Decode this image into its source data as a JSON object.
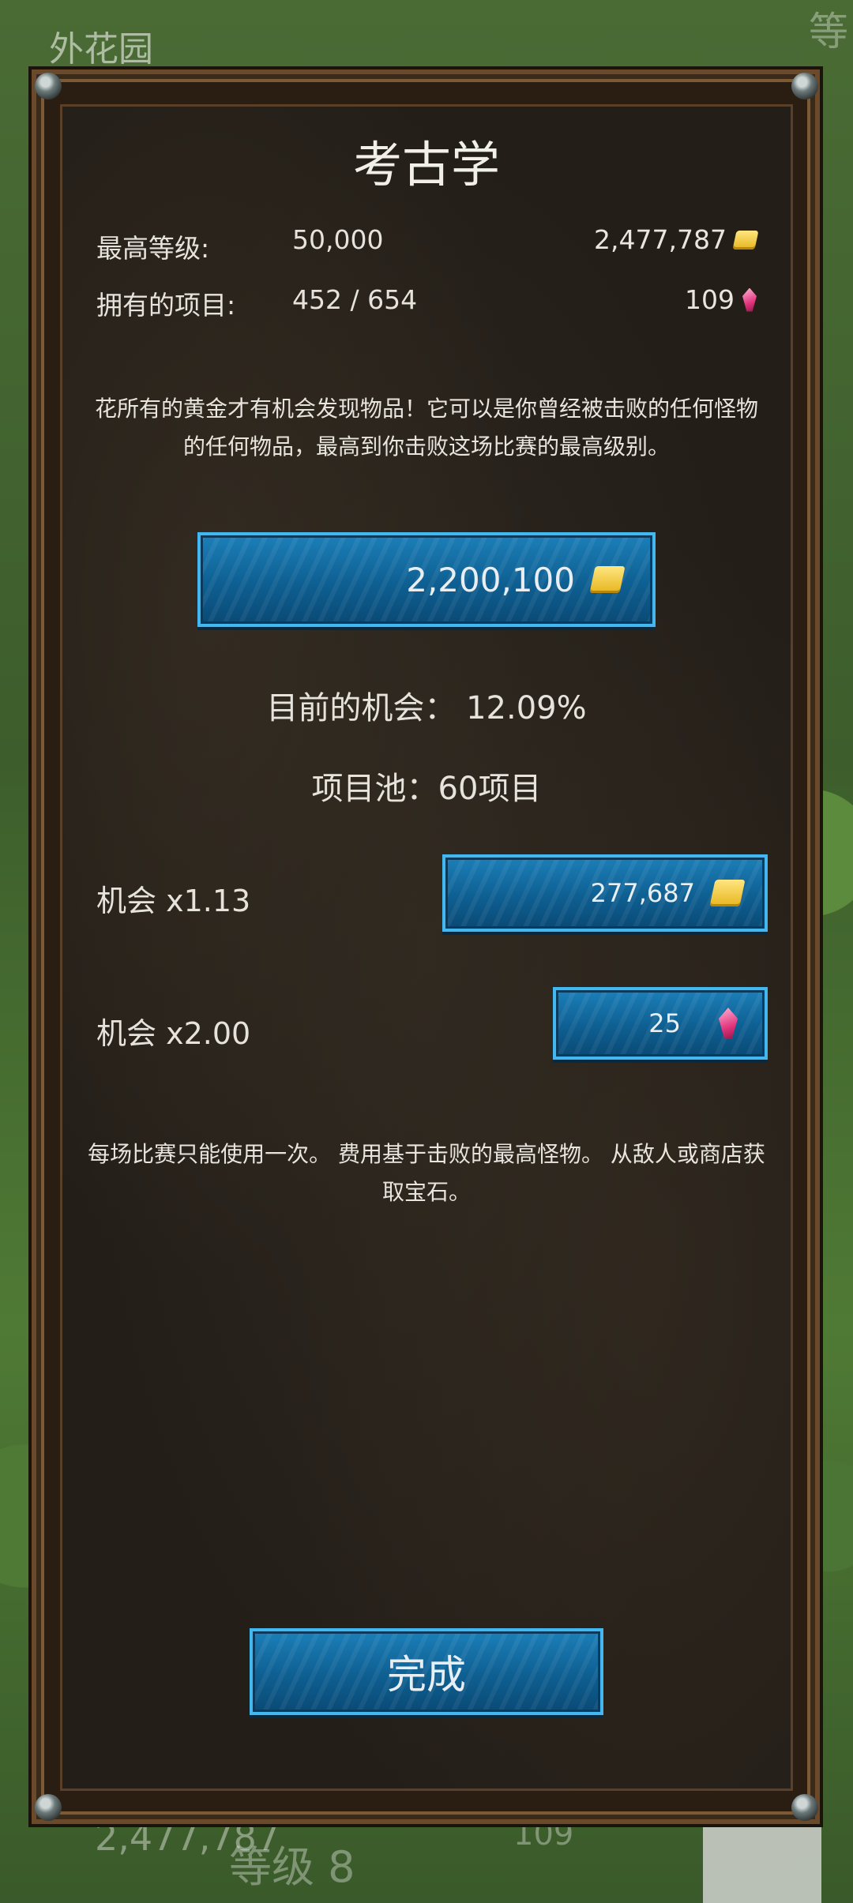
{
  "background": {
    "area_title": "外花园",
    "corner_text": "等",
    "bottom_gold": "2,477,787",
    "bottom_level": "等级 8",
    "bottom_gems": "109"
  },
  "dialog": {
    "title": "考古学",
    "stats": {
      "max_level_label": "最高等级:",
      "max_level_value": "50,000",
      "items_label": "拥有的项目:",
      "items_value": "452 / 654",
      "gold_total": "2,477,787",
      "gem_total": "109"
    },
    "description": "花所有的黄金才有机会发现物品！它可以是你曾经被击败的任何怪物的任何物品，最高到你击败这场比赛的最高级别。",
    "spend_button_value": "2,200,100",
    "current_chance": "目前的机会： 12.09%",
    "item_pool": "项目池：60项目",
    "options": [
      {
        "label": "机会 x1.13",
        "cost": "277,687",
        "currency": "gold-icon"
      },
      {
        "label": "机会 x2.00",
        "cost": "25",
        "currency": "gem-icon"
      }
    ],
    "footnote": "每场比赛只能使用一次。 费用基于击败的最高怪物。 从敌人或商店获取宝石。",
    "done_label": "完成"
  },
  "colors": {
    "button_blue": "#0e5f92",
    "button_border": "#43b7f0",
    "gold": "#e7b51e",
    "gem": "#e1367d"
  }
}
